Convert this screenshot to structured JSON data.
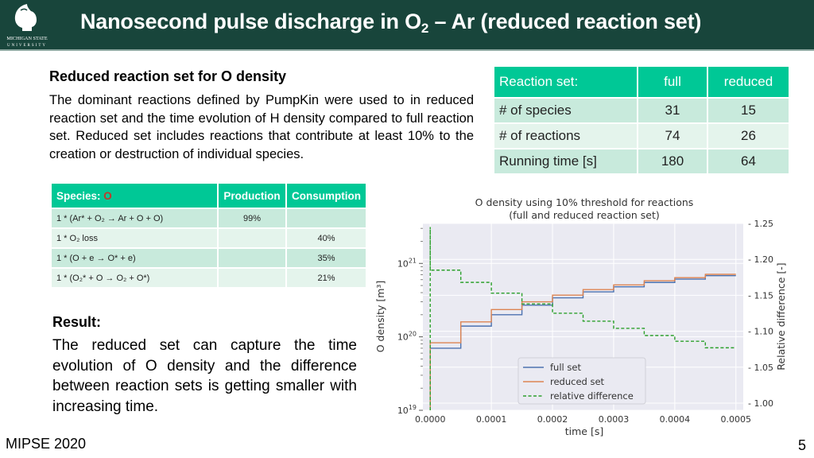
{
  "header": {
    "title_prefix": "Nanosecond pulse discharge in O",
    "title_sub": "2",
    "title_suffix": " – Ar (reduced reaction set)",
    "logo_label": "Michigan State University logo",
    "colors": {
      "bar": "#18453b"
    }
  },
  "intro": {
    "heading": "Reduced reaction set for O density",
    "text": "The dominant reactions defined by PumpKin were used to in reduced reaction set and the time evolution of H density compared to full reaction set. Reduced set includes reactions that contribute at least 10% to the creation or destruction of individual species."
  },
  "reaction_table": {
    "headers": [
      "Reaction set:",
      "full",
      "reduced"
    ],
    "rows": [
      [
        "# of species",
        "31",
        "15"
      ],
      [
        "# of reactions",
        "74",
        "26"
      ],
      [
        "Running time [s]",
        "180",
        "64"
      ]
    ],
    "colors": {
      "header": "#00c896",
      "row": "#c8eadc",
      "row_alt": "#e4f4ec"
    }
  },
  "species_table": {
    "header_label": "Species: ",
    "header_species": "O",
    "headers": [
      "Production",
      "Consumption"
    ],
    "rows": [
      {
        "reaction": "1 * (Ar* + O₂ → Ar + O + O)",
        "production": "99%",
        "consumption": ""
      },
      {
        "reaction": "1 * O₂ loss",
        "production": "",
        "consumption": "40%"
      },
      {
        "reaction": "1 * (O + e → O* + e)",
        "production": "",
        "consumption": "35%"
      },
      {
        "reaction": "1 * (O₂* + O → O₂ + O*)",
        "production": "",
        "consumption": "21%"
      }
    ]
  },
  "result": {
    "heading": "Result:",
    "text": "The reduced set can capture the time evolution of O density and the difference between reaction sets is getting smaller with increasing time."
  },
  "footer": {
    "left": "MIPSE 2020",
    "page": "5"
  },
  "chart_data": {
    "type": "line",
    "title": "O density using 10% threshold for reactions\n(full and reduced reaction set)",
    "title_lines": [
      "O density using 10% threshold for reactions",
      "(full and reduced reaction set)"
    ],
    "xlabel": "time [s]",
    "ylabel": "O density [m³]",
    "y2label": "Relative difference [-]",
    "xlim": [
      -1.2e-05,
      0.000512
    ],
    "ylim": [
      1e+19,
      3.5e+21
    ],
    "y_scale": "log",
    "y2lim": [
      0.99,
      1.25
    ],
    "x_ticks": [
      "0.0000",
      "0.0001",
      "0.0002",
      "0.0003",
      "0.0004",
      "0.0005"
    ],
    "x_tick_values": [
      0,
      0.0001,
      0.0002,
      0.0003,
      0.0004,
      0.0005
    ],
    "y_ticks": [
      "10^19",
      "10^20",
      "10^21"
    ],
    "y_tick_values": [
      1e+19,
      1e+20,
      1e+21
    ],
    "y2_ticks": [
      "1.00",
      "1.05",
      "1.10",
      "1.15",
      "1.20",
      "1.25"
    ],
    "y2_tick_values": [
      1.0,
      1.05,
      1.1,
      1.15,
      1.2,
      1.25
    ],
    "grid": true,
    "legend_position": "lower-center",
    "step_x": [
      0,
      5e-05,
      0.0001,
      0.00015,
      0.0002,
      0.00025,
      0.0003,
      0.00035,
      0.0004,
      0.00045,
      0.0005
    ],
    "series": [
      {
        "name": "full set",
        "axis": "left",
        "color": "#4c72b0",
        "style": "solid",
        "values": [
          7e+19,
          1.4e+20,
          2e+20,
          2.7e+20,
          3.4e+20,
          4.1e+20,
          4.8e+20,
          5.5e+20,
          6.1e+20,
          6.8e+20
        ]
      },
      {
        "name": "reduced set",
        "axis": "left",
        "color": "#dd8452",
        "style": "solid",
        "values": [
          8.3e+19,
          1.6e+20,
          2.35e+20,
          3e+20,
          3.7e+20,
          4.4e+20,
          5.1e+20,
          5.8e+20,
          6.4e+20,
          7.1e+20
        ]
      },
      {
        "name": "relative difference",
        "axis": "right",
        "color": "#2ca02c",
        "style": "dashed",
        "initial_spike": 1.245,
        "values": [
          1.185,
          1.168,
          1.153,
          1.138,
          1.125,
          1.114,
          1.104,
          1.094,
          1.086,
          1.077
        ]
      }
    ]
  }
}
